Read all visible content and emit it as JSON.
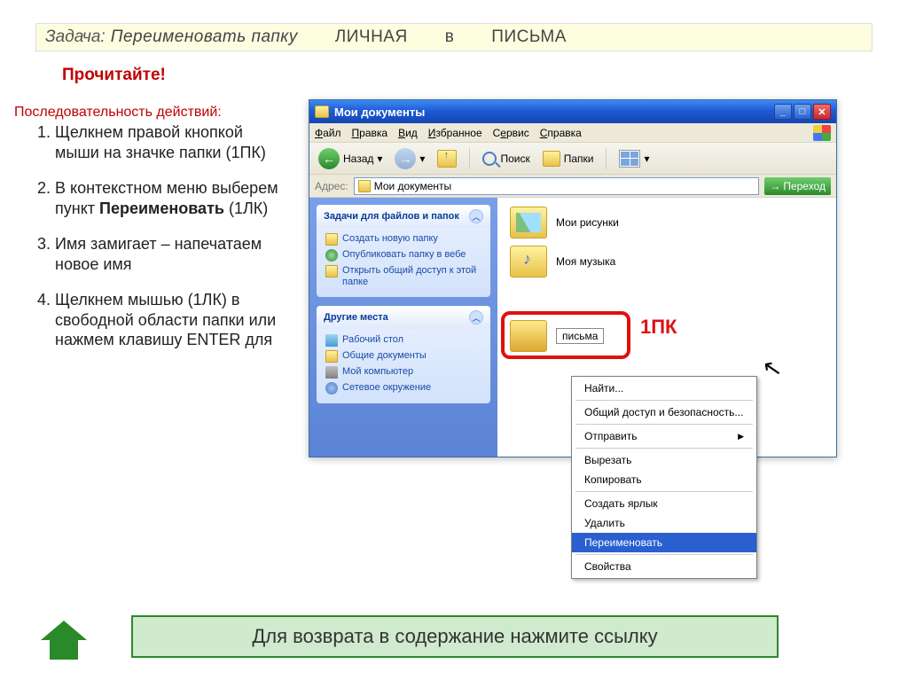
{
  "task": {
    "label": "Задача:",
    "text": "Переименовать папку",
    "from": "ЛИЧНАЯ",
    "in": "в",
    "to": "ПИСЬМА"
  },
  "read": "Прочитайте!",
  "seqlabel": "Последовательность действий:",
  "steps": {
    "s1": "Щелкнем правой кнопкой мыши на значке папки (1ПК)",
    "s2a": "В контекстном меню выберем пункт ",
    "s2b": "Переименовать",
    "s2c": " (1ЛК)",
    "s3": "Имя замигает – напечатаем новое имя",
    "s4": "Щелкнем мышью (1ЛК) в свободной области папки или нажмем клавишу ENTER для"
  },
  "window": {
    "title": "Мои документы",
    "menu": {
      "file": "Файл",
      "edit": "Правка",
      "view": "Вид",
      "fav": "Избранное",
      "tools": "Сервис",
      "help": "Справка"
    },
    "toolbar": {
      "back": "Назад",
      "search": "Поиск",
      "folders": "Папки"
    },
    "address": {
      "label": "Адрес:",
      "value": "Мои документы",
      "go": "Переход"
    },
    "tasks": {
      "hdr": "Задачи для файлов и папок",
      "i1": "Создать новую папку",
      "i2": "Опубликовать папку в вебе",
      "i3": "Открыть общий доступ к этой папке"
    },
    "places": {
      "hdr": "Другие места",
      "i1": "Рабочий стол",
      "i2": "Общие документы",
      "i3": "Мой компьютер",
      "i4": "Сетевое окружение"
    },
    "items": {
      "pics": "Мои рисунки",
      "music": "Моя музыка",
      "letters": "письма"
    }
  },
  "annotation": {
    "pk": "1ПК"
  },
  "context": {
    "find": "Найти...",
    "share": "Общий доступ и безопасность...",
    "send": "Отправить",
    "cut": "Вырезать",
    "copy": "Копировать",
    "shortcut": "Создать ярлык",
    "delete": "Удалить",
    "rename": "Переименовать",
    "props": "Свойства"
  },
  "footer": "Для возврата в содержание нажмите ссылку"
}
